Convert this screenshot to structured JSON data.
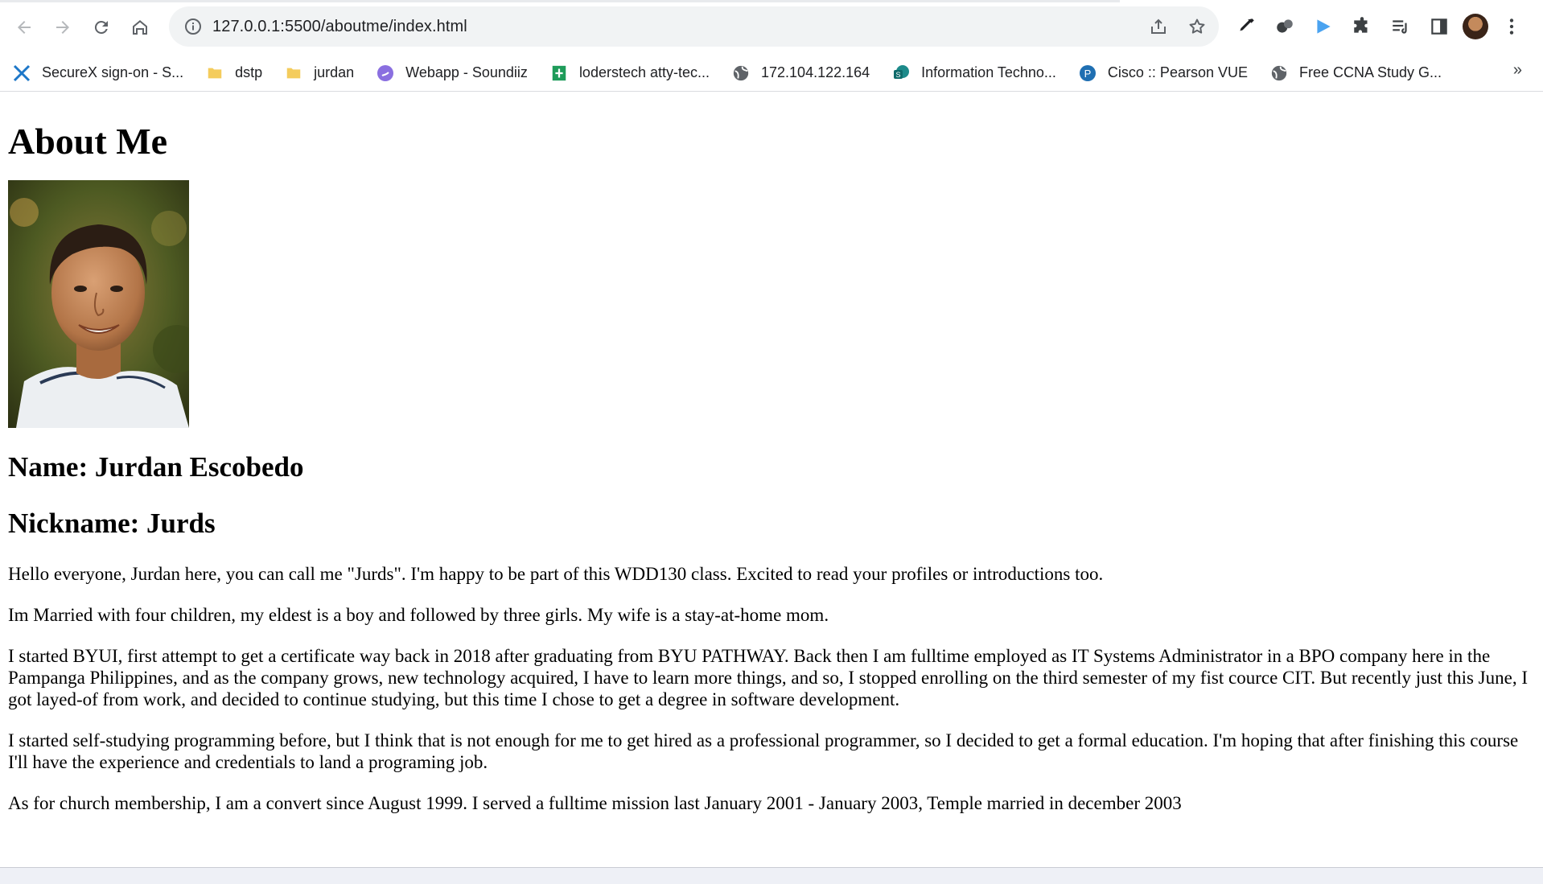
{
  "browser": {
    "url": "127.0.0.1:5500/aboutme/index.html",
    "bookmarks": [
      {
        "label": "SecureX sign-on - S...",
        "icon": "securex-icon"
      },
      {
        "label": "dstp",
        "icon": "folder-icon"
      },
      {
        "label": "jurdan",
        "icon": "folder-icon"
      },
      {
        "label": "Webapp - Soundiiz",
        "icon": "soundiiz-icon"
      },
      {
        "label": "loderstech atty-tec...",
        "icon": "sheets-icon"
      },
      {
        "label": "172.104.122.164",
        "icon": "globe-icon"
      },
      {
        "label": "Information Techno...",
        "icon": "sharepoint-icon"
      },
      {
        "label": "Cisco :: Pearson VUE",
        "icon": "pearson-icon"
      },
      {
        "label": "Free CCNA Study G...",
        "icon": "globe-icon"
      }
    ],
    "more": "»"
  },
  "page": {
    "heading": "About Me",
    "name": "Name: Jurdan Escobedo",
    "nickname": "Nickname: Jurds",
    "paragraphs": [
      "Hello everyone, Jurdan here, you can call me \"Jurds\". I'm happy to be part of this WDD130 class. Excited to read your profiles or introductions too.",
      "Im Married with four children, my eldest is a boy and followed by three girls. My wife is a stay-at-home mom.",
      "I started BYUI, first attempt to get a certificate way back in 2018 after graduating from BYU PATHWAY. Back then I am fulltime employed as IT Systems Administrator in a BPO company here in the Pampanga Philippines, and as the company grows, new technology acquired, I have to learn more things, and so, I stopped enrolling on the third semester of my fist cource CIT. But recently just this June, I got layed-of from work, and decided to continue studying, but this time I chose to get a degree in software development.",
      "I started self-studying programming before, but I think that is not enough for me to get hired as a professional programmer, so I decided to get a formal education. I'm hoping that after finishing this course I'll have the experience and credentials to land a programing job.",
      "As for church membership, I am a convert since August 1999. I served a fulltime mission last January 2001 - January 2003, Temple married in december 2003"
    ]
  }
}
